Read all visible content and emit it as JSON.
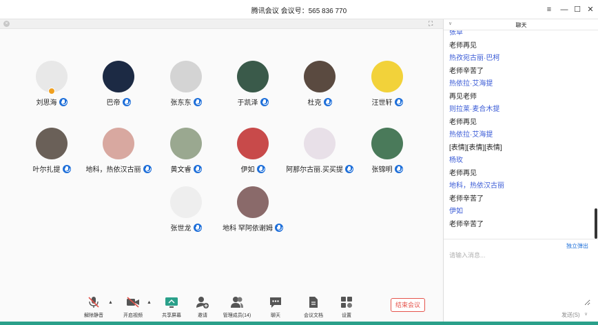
{
  "window": {
    "title": "腾讯会议 会议号：565 836 770",
    "controls": {
      "menu": "≡",
      "minimize": "—",
      "maximize": "☐",
      "close": "✕"
    }
  },
  "stage": {
    "fullscreen_icon": "fullscreen-icon",
    "members": [
      {
        "name": "刘思海",
        "avatar_color": "#e8e8e8",
        "host": true
      },
      {
        "name": "巴帝",
        "avatar_color": "#1c2a44"
      },
      {
        "name": "张东东",
        "avatar_color": "#d4d4d4"
      },
      {
        "name": "于凯泽",
        "avatar_color": "#3a5a4a"
      },
      {
        "name": "杜克",
        "avatar_color": "#5a4a40"
      },
      {
        "name": "汪世轩",
        "avatar_color": "#f2d23a"
      },
      {
        "name": "叶尔扎提",
        "avatar_color": "#6a6058"
      },
      {
        "name": "地科，热依汉古丽",
        "avatar_color": "#d8a8a0"
      },
      {
        "name": "黄文睿",
        "avatar_color": "#9aa890"
      },
      {
        "name": "伊如",
        "avatar_color": "#c84a4a"
      },
      {
        "name": "阿那尔古丽.买买提",
        "avatar_color": "#e8e0e8"
      },
      {
        "name": "张锦明",
        "avatar_color": "#4a7a5a"
      },
      {
        "name": "张世龙",
        "avatar_color": "#eeeeee"
      },
      {
        "name": "地科  罕阿依谢姆",
        "avatar_color": "#8a6a6a"
      }
    ]
  },
  "toolbar": {
    "mute_label": "解除静音",
    "video_label": "开启视频",
    "share_label": "共享屏幕",
    "invite_label": "邀请",
    "members_label": "管理成员(14)",
    "chat_label": "聊天",
    "docs_label": "会议文档",
    "settings_label": "设置",
    "end_label": "结束会议",
    "accent_green": "#2aa08a",
    "end_color": "#e5534b"
  },
  "chat": {
    "title": "聊天",
    "messages": [
      {
        "sender": "张草",
        "text": "老师再见"
      },
      {
        "sender": "热孜宛古丽·巴柯",
        "text": "老师辛苦了"
      },
      {
        "sender": "热依拉·艾海提",
        "text": "再见老师"
      },
      {
        "sender": "则拉莱·麦合木提",
        "text": "老师再见"
      },
      {
        "sender": "热依拉·艾海提",
        "text": "[表情][表情][表情]"
      },
      {
        "sender": "杨玫",
        "text": "老师再见"
      },
      {
        "sender": "地科，热依汉古丽",
        "text": "老师辛苦了"
      },
      {
        "sender": "伊如",
        "text": "老师辛苦了"
      }
    ],
    "popout_label": "独立弹出",
    "input_placeholder": "请输入消息...",
    "send_label": "发送(S)",
    "send_menu": "∨",
    "sender_color": "#3a5bd6"
  }
}
